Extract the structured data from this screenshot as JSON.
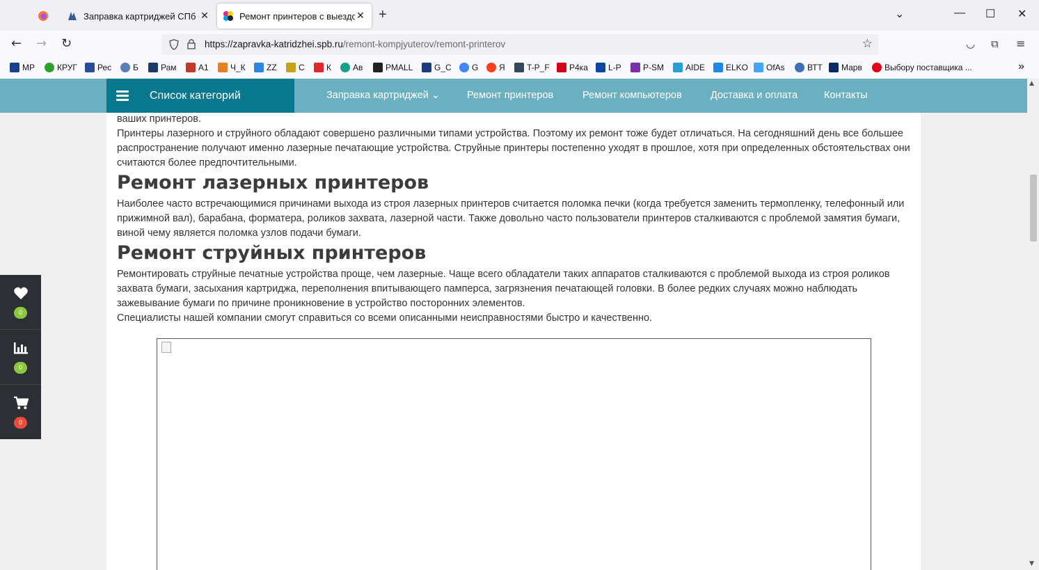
{
  "browser": {
    "tabs": [
      {
        "title": "Заправка картриджей СПб - Ц",
        "active": false
      },
      {
        "title": "Ремонт принтеров с выездом",
        "active": true
      }
    ],
    "url_host": "https://zapravka-katridzhei.spb.ru",
    "url_path": "/remont-kompjyuterov/remont-printerov",
    "bookmarks": [
      {
        "label": "МР",
        "icon": "mp-icon"
      },
      {
        "label": "КРУГ",
        "icon": "green-dot-icon"
      },
      {
        "label": "Рес",
        "icon": "rec-icon"
      },
      {
        "label": "Б",
        "icon": "globe-icon"
      },
      {
        "label": "Рам",
        "icon": "ram-icon"
      },
      {
        "label": "А1",
        "icon": "a1-icon"
      },
      {
        "label": "Ч_К",
        "icon": "ck-icon"
      },
      {
        "label": "ZZ",
        "icon": "zz-icon"
      },
      {
        "label": "С",
        "icon": "c-icon"
      },
      {
        "label": "К",
        "icon": "k-icon"
      },
      {
        "label": "Ав",
        "icon": "av-icon"
      },
      {
        "label": "PMALL",
        "icon": "pmall-icon"
      },
      {
        "label": "G_C",
        "icon": "triangle-icon"
      },
      {
        "label": "G",
        "icon": "google-icon"
      },
      {
        "label": "Я",
        "icon": "yandex-icon"
      },
      {
        "label": "T-P_F",
        "icon": "tpf-icon"
      },
      {
        "label": "Р4ка",
        "icon": "p4-icon"
      },
      {
        "label": "L-P",
        "icon": "hp-icon"
      },
      {
        "label": "P-SM",
        "icon": "psm-icon"
      },
      {
        "label": "AIDE",
        "icon": "puzzle-icon"
      },
      {
        "label": "ELKO",
        "icon": "elko-icon"
      },
      {
        "label": "OfAs",
        "icon": "ofas-icon"
      },
      {
        "label": "ВТТ",
        "icon": "btt-icon"
      },
      {
        "label": "Марв",
        "icon": "v-icon"
      },
      {
        "label": "Выбору поставщика ...",
        "icon": "red-circle-icon"
      }
    ]
  },
  "site_nav": {
    "categories_label": "Список категорий",
    "items": [
      "Заправка картриджей ⌄",
      "Ремонт принтеров",
      "Ремонт компьютеров",
      "Доставка и оплата",
      "Контакты"
    ]
  },
  "content": {
    "intro_fragment": "ваших принтеров.",
    "intro_para": "Принтеры лазерного и струйного обладают совершено различными типами устройства. Поэтому их ремонт тоже будет отличаться. На сегодняшний день все большее распространение получают именно лазерные печатающие устройства. Струйные принтеры постепенно уходят в прошлое, хотя при определенных обстоятельствах они считаются более предпочтительными.",
    "heading_laser": "Ремонт лазерных принтеров",
    "laser_para": "Наиболее часто встречающимися причинами выхода из строя лазерных принтеров считается поломка печки (когда требуется заменить термопленку, телефонный или прижимной вал), барабана, форматера, роликов захвата, лазерной части. Также довольно часто пользователи принтеров сталкиваются с проблемой замятия бумаги, виной чему является поломка узлов подачи бумаги.",
    "heading_inkjet": "Ремонт струйных принтеров",
    "inkjet_para": "Ремонтировать струйные печатные устройства проще, чем лазерные. Чаще всего обладатели таких аппаратов сталкиваются с проблемой выхода из строя роликов захвата бумаги, засыхания картриджа, переполнения впитывающего памперса, загрязнения печатающей головки. В более редких случаях можно наблюдать зажевывание бумаги по причине проникновение в устройство посторонних элементов.",
    "closing_para": "Специалисты нашей компании смогут справиться со всеми описанными неисправностями быстро и качественно."
  },
  "side_widget": {
    "favorites_count": "0",
    "compare_count": "0",
    "cart_count": "0"
  },
  "colors": {
    "nav_bg": "#6ab0c1",
    "category_bg": "#08788e",
    "badge_green": "#8dc63f",
    "badge_red": "#e74c3c"
  }
}
